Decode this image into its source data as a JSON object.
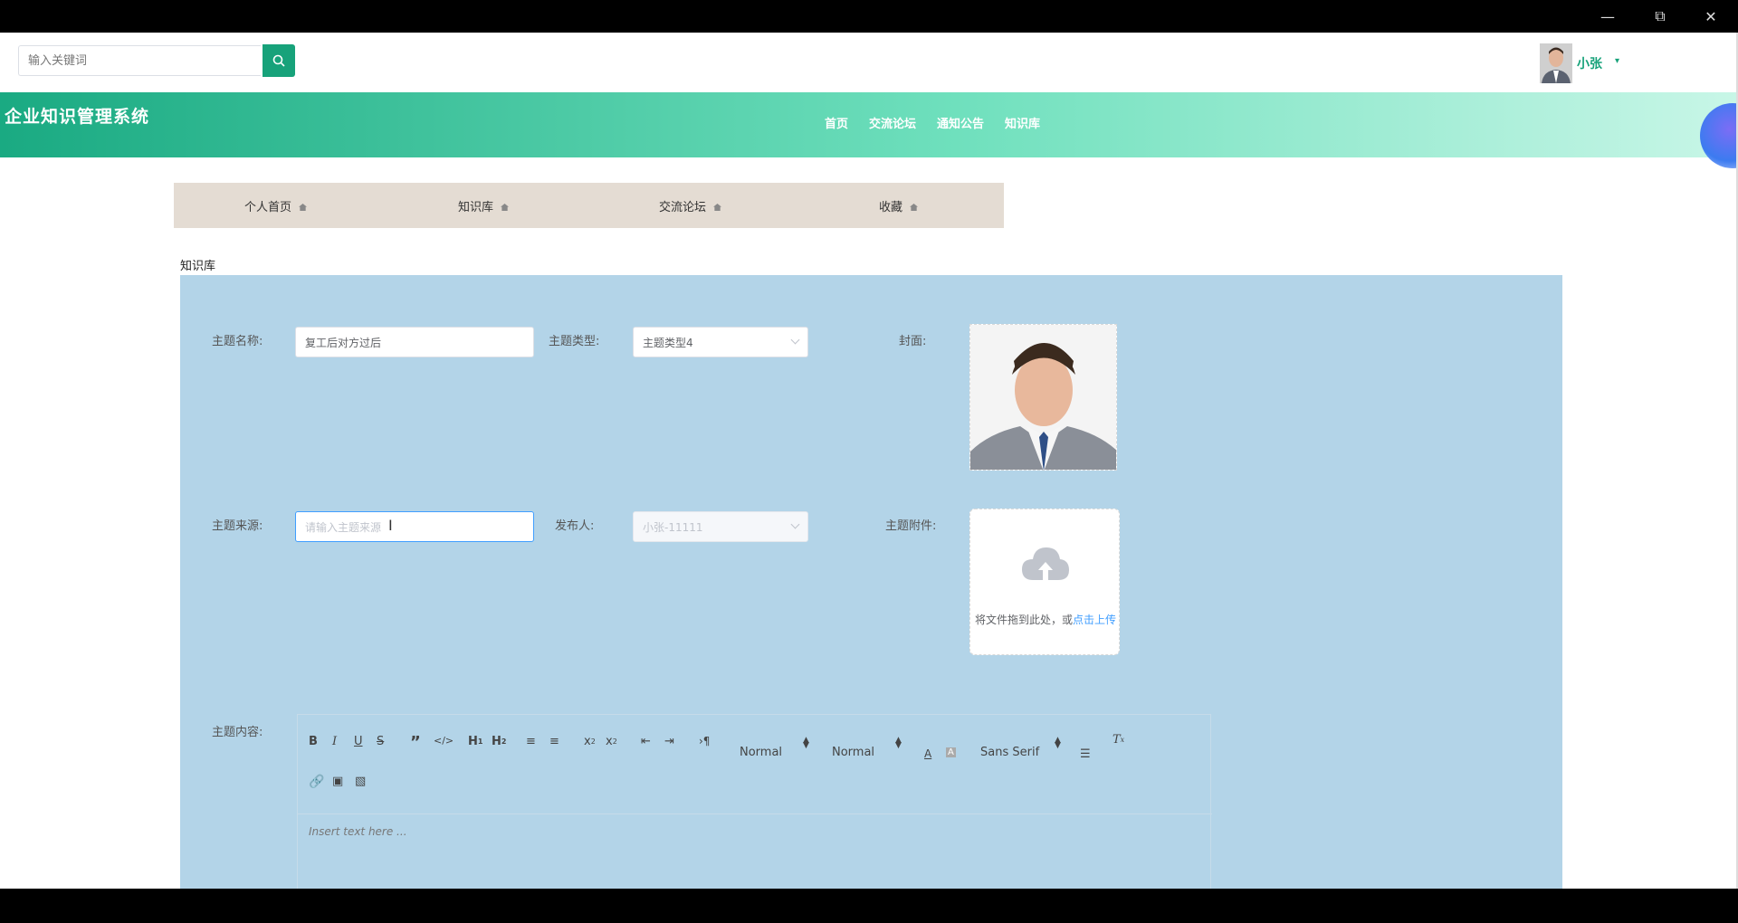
{
  "search": {
    "placeholder": "输入关键词"
  },
  "user": {
    "name": "小张"
  },
  "site": {
    "title": "企业知识管理系统"
  },
  "nav": [
    "首页",
    "交流论坛",
    "通知公告",
    "知识库"
  ],
  "subnav": [
    "个人首页",
    "知识库",
    "交流论坛",
    "收藏"
  ],
  "section": {
    "title": "知识库"
  },
  "form": {
    "name_label": "主题名称:",
    "name_value": "复工后对方过后",
    "type_label": "主题类型:",
    "type_value": "主题类型4",
    "cover_label": "封面:",
    "source_label": "主题来源:",
    "source_placeholder": "请输入主题来源",
    "publisher_label": "发布人:",
    "publisher_value": "小张-11111",
    "attachment_label": "主题附件:",
    "upload_text": "将文件拖到此处，或",
    "upload_link": "点击上传",
    "content_label": "主题内容:"
  },
  "editor": {
    "header_select": "Normal",
    "size_select": "Normal",
    "font_select": "Sans Serif",
    "placeholder": "Insert text here ..."
  },
  "colors": {
    "accent": "#17a27a",
    "panel": "#b3d4e8",
    "subnav": "#e4dcd3",
    "link": "#409eff"
  }
}
